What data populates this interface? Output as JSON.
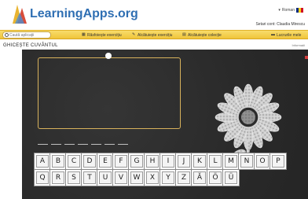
{
  "header": {
    "site_name": "LearningApps.org",
    "language": "Roman",
    "user_label": "Setari cont: Claudia Mirescu",
    "flag_colors": [
      "#002b7f",
      "#fcd116",
      "#ce1126"
    ]
  },
  "nav": {
    "search_placeholder": "Caută aplicații",
    "items": [
      {
        "label": "Răsfoiește exercițiu",
        "icon": "grid-icon"
      },
      {
        "label": "Alcătuiește exercițiu",
        "icon": "pencil-icon"
      },
      {
        "label": "Alcătuiește colecție",
        "icon": "collection-icon"
      },
      {
        "label": "Lucrurile mele",
        "icon": "folder-icon"
      }
    ]
  },
  "app": {
    "title": "GHICEȘTE CUVÂNTUL",
    "link": "Informații",
    "colors": {
      "frame": "#d8b25c",
      "board": "#2b2b2b"
    },
    "blank_count": 7,
    "keys_row1": [
      "A",
      "B",
      "C",
      "D",
      "E",
      "F",
      "G",
      "H",
      "I",
      "J",
      "K",
      "L",
      "M",
      "N",
      "O",
      "P"
    ],
    "keys_row2": [
      "Q",
      "R",
      "S",
      "T",
      "U",
      "V",
      "W",
      "X",
      "Y",
      "Z",
      "Ă",
      "Ö",
      "Ü"
    ]
  }
}
